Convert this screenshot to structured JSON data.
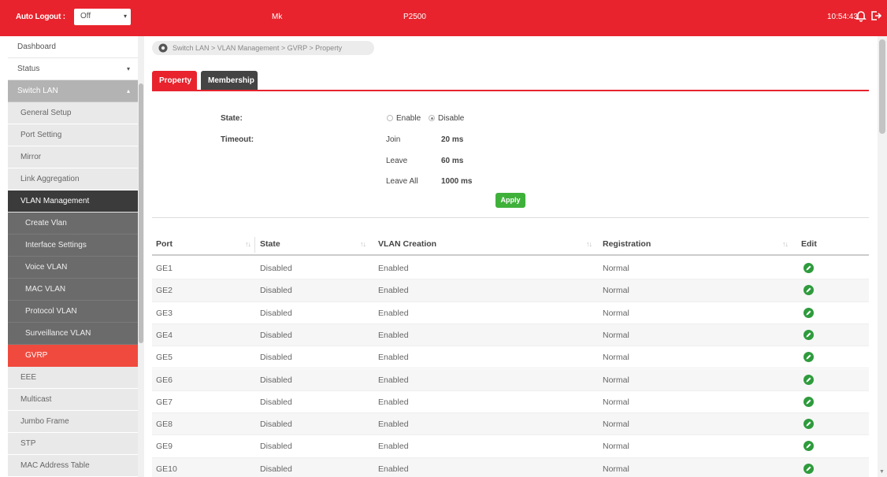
{
  "topbar": {
    "auto_logout_label": "Auto Logout :",
    "auto_logout_value": "Off",
    "model_left": "Mk",
    "model_right": "P2500",
    "time": "10:54:43"
  },
  "sidebar": {
    "items": [
      {
        "label": "Dashboard"
      },
      {
        "label": "Status"
      },
      {
        "label": "Switch LAN"
      },
      {
        "label": "General Setup"
      },
      {
        "label": "Port Setting"
      },
      {
        "label": "Mirror"
      },
      {
        "label": "Link Aggregation"
      },
      {
        "label": "VLAN Management"
      },
      {
        "label": "Create Vlan"
      },
      {
        "label": "Interface Settings"
      },
      {
        "label": "Voice VLAN"
      },
      {
        "label": "MAC VLAN"
      },
      {
        "label": "Protocol VLAN"
      },
      {
        "label": "Surveillance VLAN"
      },
      {
        "label": "GVRP"
      },
      {
        "label": "EEE"
      },
      {
        "label": "Multicast"
      },
      {
        "label": "Jumbo Frame"
      },
      {
        "label": "STP"
      },
      {
        "label": "MAC Address Table"
      }
    ]
  },
  "breadcrumb": "Switch LAN > VLAN Management > GVRP > Property",
  "tabs": [
    "Property",
    "Membership"
  ],
  "form": {
    "state_label": "State:",
    "enable_label": "Enable",
    "disable_label": "Disable",
    "state_value": "Disable",
    "timeout_label": "Timeout:",
    "join_label": "Join",
    "join_value": "20 ms",
    "leave_label": "Leave",
    "leave_value": "60 ms",
    "leave_all_label": "Leave All",
    "leave_all_value": "1000 ms",
    "apply_label": "Apply"
  },
  "table": {
    "headers": [
      "Port",
      "State",
      "VLAN Creation",
      "Registration",
      "Edit"
    ],
    "rows": [
      {
        "port": "GE1",
        "state": "Disabled",
        "vlan_creation": "Enabled",
        "registration": "Normal"
      },
      {
        "port": "GE2",
        "state": "Disabled",
        "vlan_creation": "Enabled",
        "registration": "Normal"
      },
      {
        "port": "GE3",
        "state": "Disabled",
        "vlan_creation": "Enabled",
        "registration": "Normal"
      },
      {
        "port": "GE4",
        "state": "Disabled",
        "vlan_creation": "Enabled",
        "registration": "Normal"
      },
      {
        "port": "GE5",
        "state": "Disabled",
        "vlan_creation": "Enabled",
        "registration": "Normal"
      },
      {
        "port": "GE6",
        "state": "Disabled",
        "vlan_creation": "Enabled",
        "registration": "Normal"
      },
      {
        "port": "GE7",
        "state": "Disabled",
        "vlan_creation": "Enabled",
        "registration": "Normal"
      },
      {
        "port": "GE8",
        "state": "Disabled",
        "vlan_creation": "Enabled",
        "registration": "Normal"
      },
      {
        "port": "GE9",
        "state": "Disabled",
        "vlan_creation": "Enabled",
        "registration": "Normal"
      },
      {
        "port": "GE10",
        "state": "Disabled",
        "vlan_creation": "Enabled",
        "registration": "Normal"
      }
    ]
  },
  "colors": {
    "brand_red": "#e8232d",
    "apply_green": "#3fb13b",
    "edit_green": "#2e9b3c"
  }
}
